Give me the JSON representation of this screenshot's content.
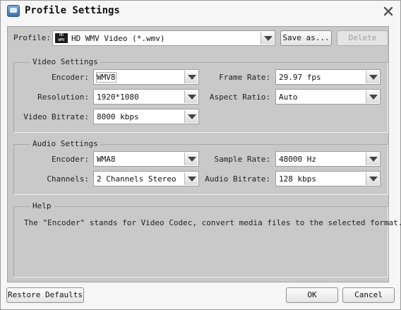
{
  "window": {
    "title": "Profile Settings"
  },
  "profile": {
    "label": "Profile:",
    "value": "HD WMV Video (*.wmv)",
    "badge_top": "HD",
    "badge_bottom": "WMV",
    "save_as_label": "Save as...",
    "delete_label": "Delete"
  },
  "video": {
    "title": "Video Settings",
    "encoder_label": "Encoder:",
    "encoder_value": "WMV8",
    "resolution_label": "Resolution:",
    "resolution_value": "1920*1080",
    "bitrate_label": "Video Bitrate:",
    "bitrate_value": "8000 kbps",
    "framerate_label": "Frame Rate:",
    "framerate_value": "29.97 fps",
    "aspect_label": "Aspect Ratio:",
    "aspect_value": "Auto"
  },
  "audio": {
    "title": "Audio Settings",
    "encoder_label": "Encoder:",
    "encoder_value": "WMA8",
    "channels_label": "Channels:",
    "channels_value": "2 Channels Stereo",
    "samplerate_label": "Sample Rate:",
    "samplerate_value": "48000 Hz",
    "bitrate_label": "Audio Bitrate:",
    "bitrate_value": "128 kbps"
  },
  "help": {
    "title": "Help",
    "text": "The \"Encoder\" stands for Video Codec, convert media files to the selected format."
  },
  "footer": {
    "restore_label": "Restore Defaults",
    "ok_label": "OK",
    "cancel_label": "Cancel"
  },
  "icons": {
    "app": "video-app-icon",
    "close": "close-icon",
    "dropdown": "chevron-down-icon",
    "format_badge": "wmv-format-icon"
  }
}
